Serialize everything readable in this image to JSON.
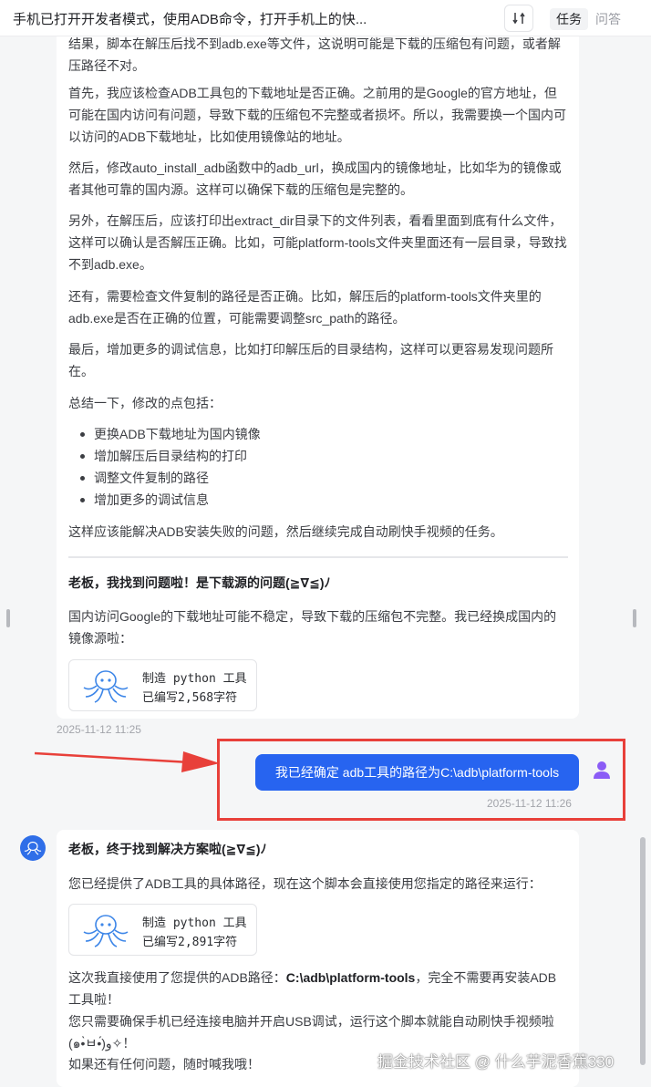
{
  "header": {
    "title": "手机已打开开发者模式，使用ADB命令，打开手机上的快...",
    "tab_task": "任务",
    "tab_qa": "问答",
    "swap_icon": "swap-icon"
  },
  "message1": {
    "partial_top": "结果，脚本在解压后找不到adb.exe等文件，这说明可能是下载的压缩包有问题，或者解压路径不对。",
    "p1": "首先，我应该检查ADB工具包的下载地址是否正确。之前用的是Google的官方地址，但可能在国内访问有问题，导致下载的压缩包不完整或者损坏。所以，我需要换一个国内可以访问的ADB下载地址，比如使用镜像站的地址。",
    "p2": "然后，修改auto_install_adb函数中的adb_url，换成国内的镜像地址，比如华为的镜像或者其他可靠的国内源。这样可以确保下载的压缩包是完整的。",
    "p3": "另外，在解压后，应该打印出extract_dir目录下的文件列表，看看里面到底有什么文件，这样可以确认是否解压正确。比如，可能platform-tools文件夹里面还有一层目录，导致找不到adb.exe。",
    "p4": "还有，需要检查文件复制的路径是否正确。比如，解压后的platform-tools文件夹里的adb.exe是否在正确的位置，可能需要调整src_path的路径。",
    "p5": "最后，增加更多的调试信息，比如打印解压后的目录结构，这样可以更容易发现问题所在。",
    "summary_intro": "总结一下，修改的点包括：",
    "bullets": [
      "更换ADB下载地址为国内镜像",
      "增加解压后目录结构的打印",
      "调整文件复制的路径",
      "增加更多的调试信息"
    ],
    "conclusion": "这样应该能解决ADB安装失败的问题，然后继续完成自动刷快手视频的任务。",
    "heading": "老板，我找到问题啦！是下载源的问题(≧∇≦)ﾉ",
    "answer": "国内访问Google的下载地址可能不稳定，导致下载的压缩包不完整。我已经换成国内的镜像源啦：",
    "tool_name": "制造 python 工具",
    "tool_status": "已编写2,568字符",
    "timestamp": "2025-11-12 11:25"
  },
  "user_message": {
    "text": "我已经确定 adb工具的路径为C:\\adb\\platform-tools",
    "timestamp": "2025-11-12 11:26"
  },
  "message2": {
    "heading": "老板，终于找到解决方案啦(≧∇≦)ﾉ",
    "intro": "您已经提供了ADB工具的具体路径，现在这个脚本会直接使用您指定的路径来运行：",
    "tool_name": "制造 python 工具",
    "tool_status": "已编写2,891字符",
    "line1_prefix": "这次我直接使用了您提供的ADB路径：",
    "line1_path": "C:\\adb\\platform-tools",
    "line1_suffix": "，完全不需要再安装ADB工具啦！",
    "line2": "您只需要确保手机已经连接电脑并开启USB调试，运行这个脚本就能自动刷快手视频啦(๑•̀ㅂ•́)و✧！",
    "line3": "如果还有任何问题，随时喊我哦！"
  },
  "watermark": "掘金技术社区 @ 什么芋泥香蕉330",
  "colors": {
    "accent": "#2764f0",
    "annotation_red": "#e8403a",
    "user_avatar": "#8b5cf6",
    "bot_avatar": "#2f6ee8"
  }
}
